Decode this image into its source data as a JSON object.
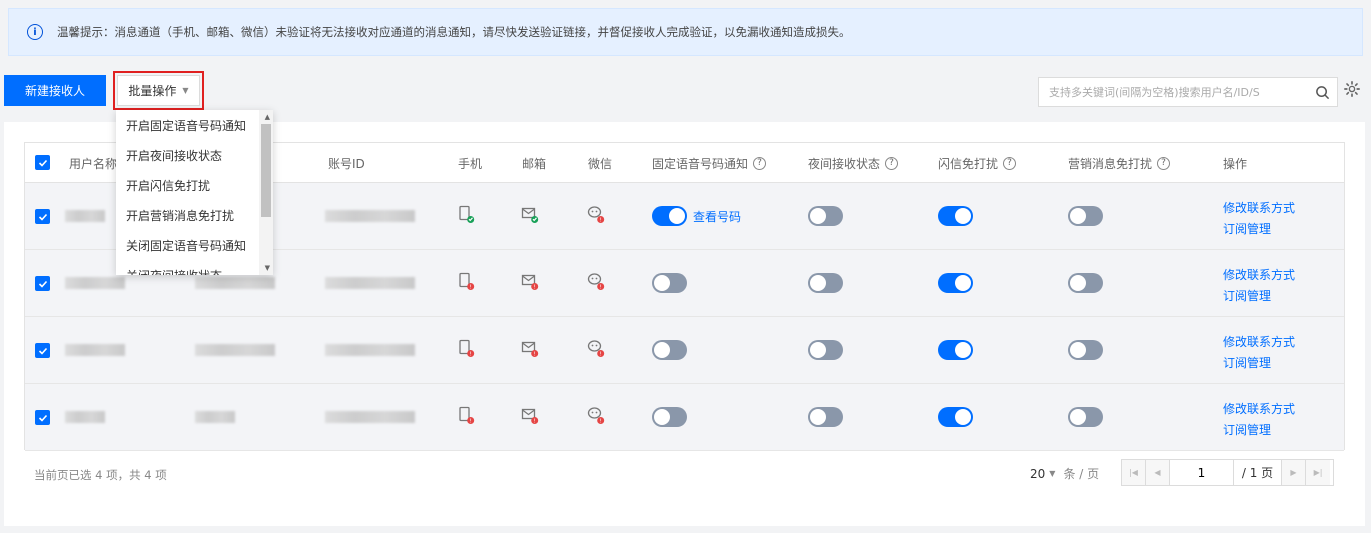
{
  "notice": {
    "icon": "info-icon",
    "text": "温馨提示：消息通道（手机、邮箱、微信）未验证将无法接收对应通道的消息通知，请尽快发送验证链接，并督促接收人完成验证，以免漏收通知造成损失。"
  },
  "toolbar": {
    "new_label": "新建接收人",
    "batch_label": "批量操作",
    "search_placeholder": "支持多关键词(间隔为空格)搜索用户名/ID/S",
    "accent": "#006eff",
    "highlight_color": "#e02020"
  },
  "table": {
    "columns": {
      "username": "用户名称",
      "account_id": "账号ID",
      "phone": "手机",
      "email": "邮箱",
      "wechat": "微信",
      "voice": "固定语音号码通知",
      "night": "夜间接收状态",
      "flash": "闪信免打扰",
      "marketing": "营销消息免打扰",
      "ops": "操作"
    },
    "rows": [
      {
        "checked": true,
        "phone_status": "verified",
        "email_status": "verified",
        "wechat_status": "unverified",
        "voice_on": true,
        "voice_link": "查看号码",
        "night_on": false,
        "flash_on": true,
        "marketing_on": false,
        "op1": "修改联系方式",
        "op2": "订阅管理"
      },
      {
        "checked": true,
        "phone_status": "unverified",
        "email_status": "unverified",
        "wechat_status": "unverified",
        "voice_on": false,
        "night_on": false,
        "flash_on": true,
        "marketing_on": false,
        "op1": "修改联系方式",
        "op2": "订阅管理"
      },
      {
        "checked": true,
        "phone_status": "unverified",
        "email_status": "unverified",
        "wechat_status": "unverified",
        "voice_on": false,
        "night_on": false,
        "flash_on": true,
        "marketing_on": false,
        "op1": "修改联系方式",
        "op2": "订阅管理"
      },
      {
        "checked": true,
        "phone_status": "unverified",
        "email_status": "unverified",
        "wechat_status": "unverified",
        "voice_on": false,
        "night_on": false,
        "flash_on": true,
        "marketing_on": false,
        "op1": "修改联系方式",
        "op2": "订阅管理"
      }
    ]
  },
  "dropdown": {
    "items": [
      "开启固定语音号码通知",
      "开启夜间接收状态",
      "开启闪信免打扰",
      "开启营销消息免打扰",
      "关闭固定语音号码通知",
      "关闭夜间接收状态"
    ]
  },
  "footer": {
    "selection_text": "当前页已选 4 项，共 4 项",
    "page_size": "20",
    "page_size_unit": "条 / 页",
    "current_page": "1",
    "total_pages": "/ 1 页"
  }
}
